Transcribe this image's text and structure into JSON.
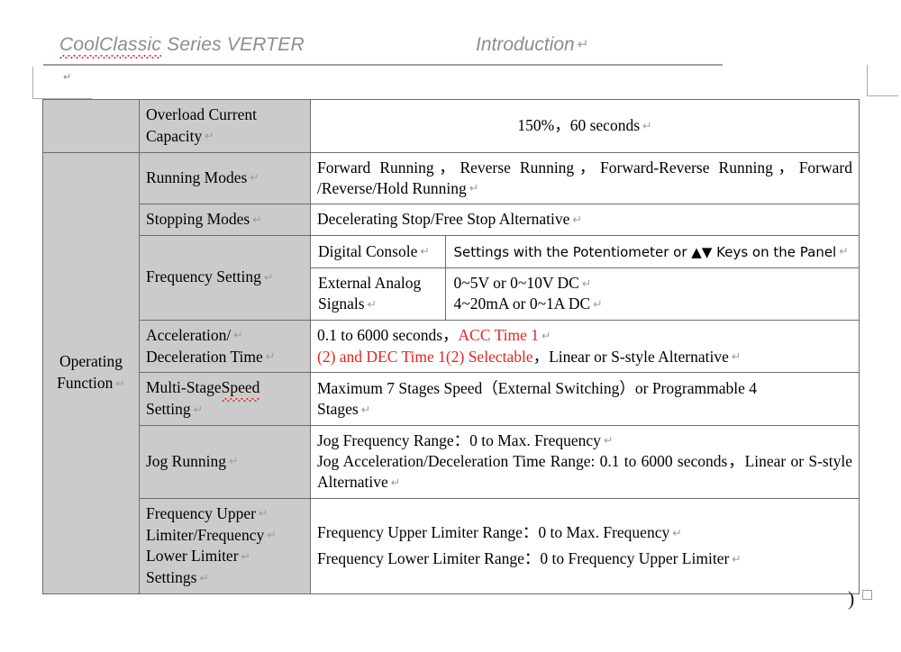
{
  "header": {
    "left_spellchecked": "CoolClassic",
    "left_rest": " Series VERTER",
    "right": "Introduction",
    "pilcrow": "↵"
  },
  "table": {
    "group_label": "Operating Function",
    "rows": [
      {
        "name": "overload-current-capacity",
        "group": "",
        "label": "Overload Current Capacity",
        "value": "150%，60 seconds",
        "align": "center"
      },
      {
        "name": "running-modes",
        "label": "Running Modes",
        "value": "Forward Running，Reverse Running，Forward-Reverse Running，Forward /Reverse/Hold Running",
        "align": "justify"
      },
      {
        "name": "stopping-modes",
        "label": "Stopping Modes",
        "value": "Decelerating Stop/Free Stop Alternative",
        "align": "left"
      },
      {
        "name": "frequency-setting",
        "label": "Frequency Setting",
        "subrows": [
          {
            "name": "digital-console",
            "sublabel": "Digital Console",
            "value": "Settings with the Potentiometer or ▲▼ Keys on the Panel"
          },
          {
            "name": "external-analog-signals",
            "sublabel": "External Analog Signals",
            "line1": "0~5V or 0~10V DC",
            "line2": "4~20mA or 0~1A DC"
          }
        ]
      },
      {
        "name": "acceleration-deceleration-time",
        "label_line1": "Acceleration/",
        "label_line2": "Deceleration Time",
        "value_black_1": "0.1 to 6000 seconds，",
        "value_red_1": "ACC Time 1",
        "value_red_2": "(2) and DEC Time 1(2) Selectable",
        "value_black_2": "，Linear or S-style Alternative"
      },
      {
        "name": "multi-stage-speed-setting",
        "label_line1_a": "Multi-Stage",
        "label_line1_b": "Speed",
        "label_line2": "Setting",
        "value_line1": "Maximum 7 Stages Speed（External Switching）or Programmable 4",
        "value_line2": "Stages"
      },
      {
        "name": "jog-running",
        "label": "Jog Running",
        "value_line1": "Jog Frequency Range：0 to Max. Frequency",
        "value_line2": "Jog Acceleration/Deceleration Time Range: 0.1 to 6000 seconds，Linear or S-style Alternative"
      },
      {
        "name": "frequency-limiter-settings",
        "label_lines": [
          "Frequency Upper",
          "Limiter/Frequency",
          "Lower Limiter",
          "Settings"
        ],
        "value_line1": "Frequency Upper Limiter Range：0 to Max. Frequency",
        "value_line2": "Frequency Lower Limiter Range：0 to Frequency Upper Limiter"
      }
    ]
  },
  "marks": {
    "tail_paren": ")"
  },
  "colors": {
    "shade": "#cbcbcb",
    "border": "#6d6d6d",
    "red": "#e8231f",
    "header_gray": "#8d8d8d"
  }
}
